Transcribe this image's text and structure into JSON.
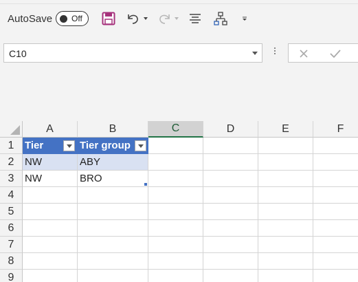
{
  "qat": {
    "autosave_label": "AutoSave",
    "autosave_state": "Off"
  },
  "formula_bar": {
    "namebox_value": "C10"
  },
  "sheet": {
    "columns": [
      "A",
      "B",
      "C",
      "D",
      "E",
      "F"
    ],
    "rows": [
      "1",
      "2",
      "3",
      "4",
      "5",
      "6",
      "7",
      "8",
      "9"
    ],
    "active_column": "C",
    "table": {
      "headers": [
        "Tier",
        "Tier group"
      ],
      "rows": [
        [
          "NW",
          "ABY"
        ],
        [
          "NW",
          "BRO"
        ]
      ]
    }
  },
  "colors": {
    "table_header": "#4472c4",
    "table_band": "#d9e1f2",
    "accent": "#217346",
    "save_icon": "#a6327c"
  }
}
